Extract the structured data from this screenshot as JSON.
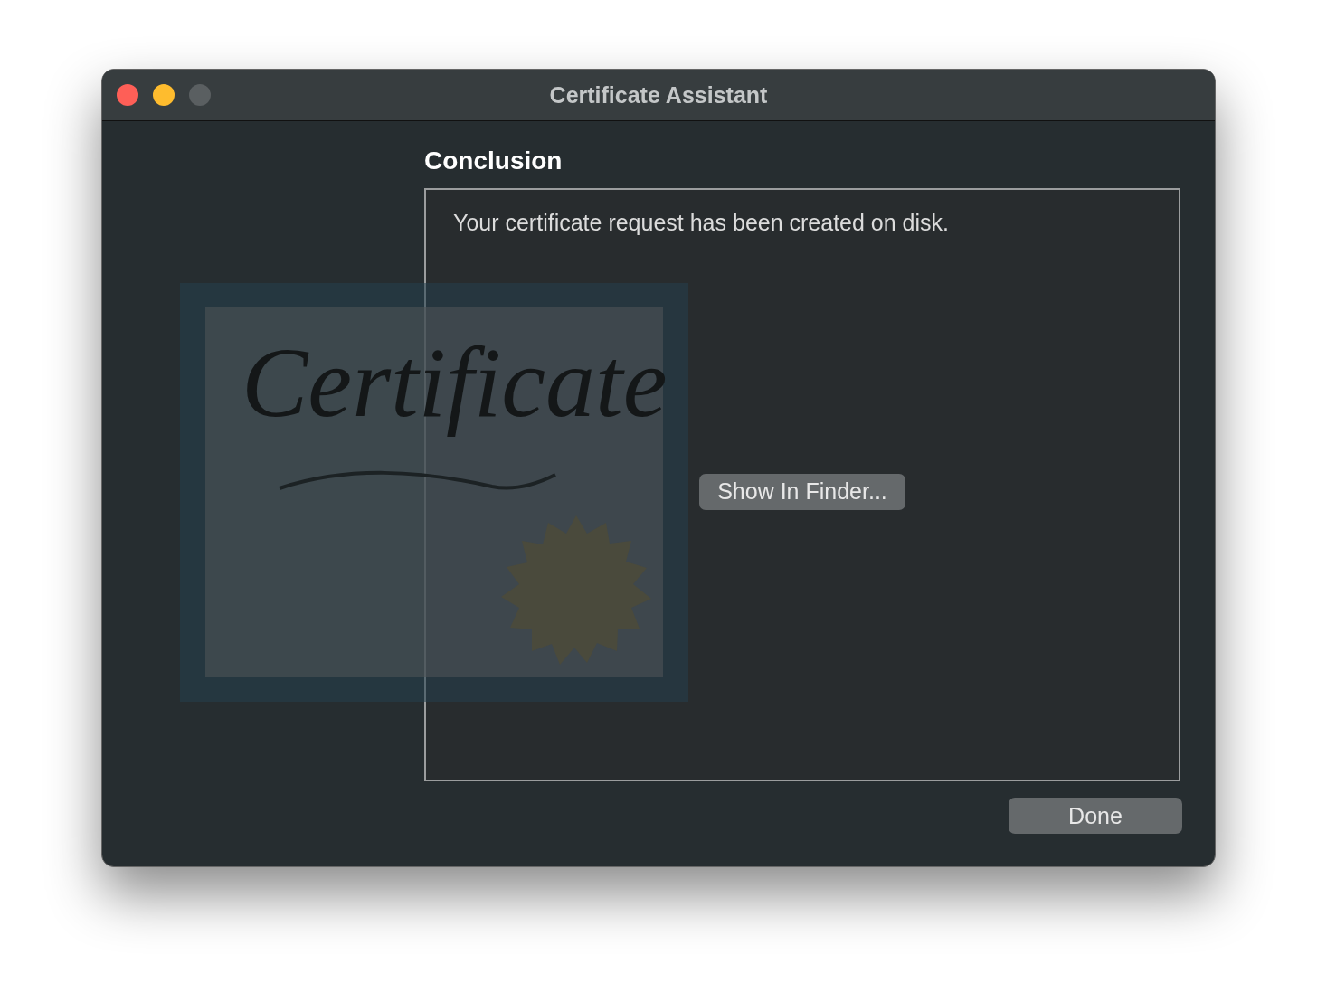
{
  "window": {
    "title": "Certificate Assistant"
  },
  "heading": "Conclusion",
  "message": "Your certificate request has been created on disk.",
  "artwork_title": "Certificate",
  "buttons": [
    {
      "kind": "inline",
      "label": "Show In Finder..."
    },
    {
      "kind": "footer",
      "label": "Done"
    }
  ]
}
